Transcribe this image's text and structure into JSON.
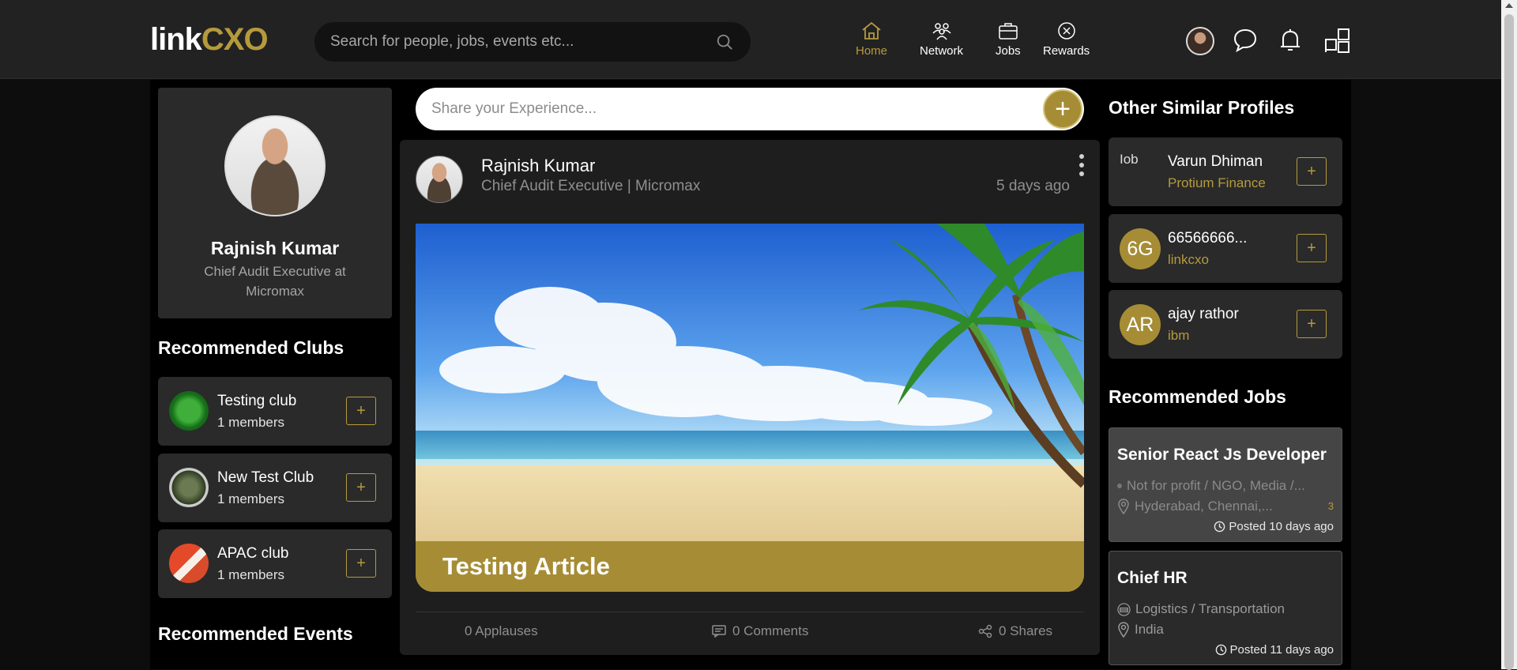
{
  "header": {
    "logo_part1": "link",
    "logo_part2": "CXO",
    "search_placeholder": "Search for people, jobs, events etc...",
    "nav": [
      {
        "label": "Home",
        "icon": "home-icon",
        "active": true
      },
      {
        "label": "Network",
        "icon": "network-icon",
        "active": false
      },
      {
        "label": "Jobs",
        "icon": "briefcase-icon",
        "active": false
      },
      {
        "label": "Rewards",
        "icon": "rewards-icon",
        "active": false
      }
    ]
  },
  "profile": {
    "name": "Rajnish Kumar",
    "role": "Chief Audit Executive at Micromax"
  },
  "clubs": {
    "title": "Recommended Clubs",
    "items": [
      {
        "name": "Testing club",
        "members": "1 members"
      },
      {
        "name": "New Test Club",
        "members": "1 members"
      },
      {
        "name": "APAC club",
        "members": "1 members"
      }
    ]
  },
  "events": {
    "title": "Recommended Events"
  },
  "share": {
    "placeholder": "Share your Experience..."
  },
  "post": {
    "author": "Rajnish Kumar",
    "role": "Chief Audit Executive | Micromax",
    "time": "5 days ago",
    "caption": "Testing Article",
    "applauses": "0 Applauses",
    "comments": "0 Comments",
    "shares": "0 Shares"
  },
  "similar": {
    "title": "Other Similar Profiles",
    "items": [
      {
        "initials": "Iob",
        "name": "Varun Dhiman",
        "company": "Protium Finance"
      },
      {
        "initials": "6G",
        "name": "66566666...",
        "company": "linkcxo"
      },
      {
        "initials": "AR",
        "name": "ajay rathor",
        "company": "ibm"
      }
    ]
  },
  "jobs": {
    "title": "Recommended Jobs",
    "items": [
      {
        "title": "Senior React Js Developer",
        "industry": "Not for profit / NGO, Media /...",
        "location": "Hyderabad, Chennai,...",
        "count": "3",
        "posted": "Posted 10 days ago"
      },
      {
        "title": "Chief HR",
        "industry": "Logistics / Transportation",
        "location": "India",
        "posted": "Posted 11 days ago"
      }
    ]
  },
  "colors": {
    "accent": "#b59a3c",
    "gold_fill": "#a68d35",
    "header": "#222222",
    "card": "#2a2a2a"
  }
}
